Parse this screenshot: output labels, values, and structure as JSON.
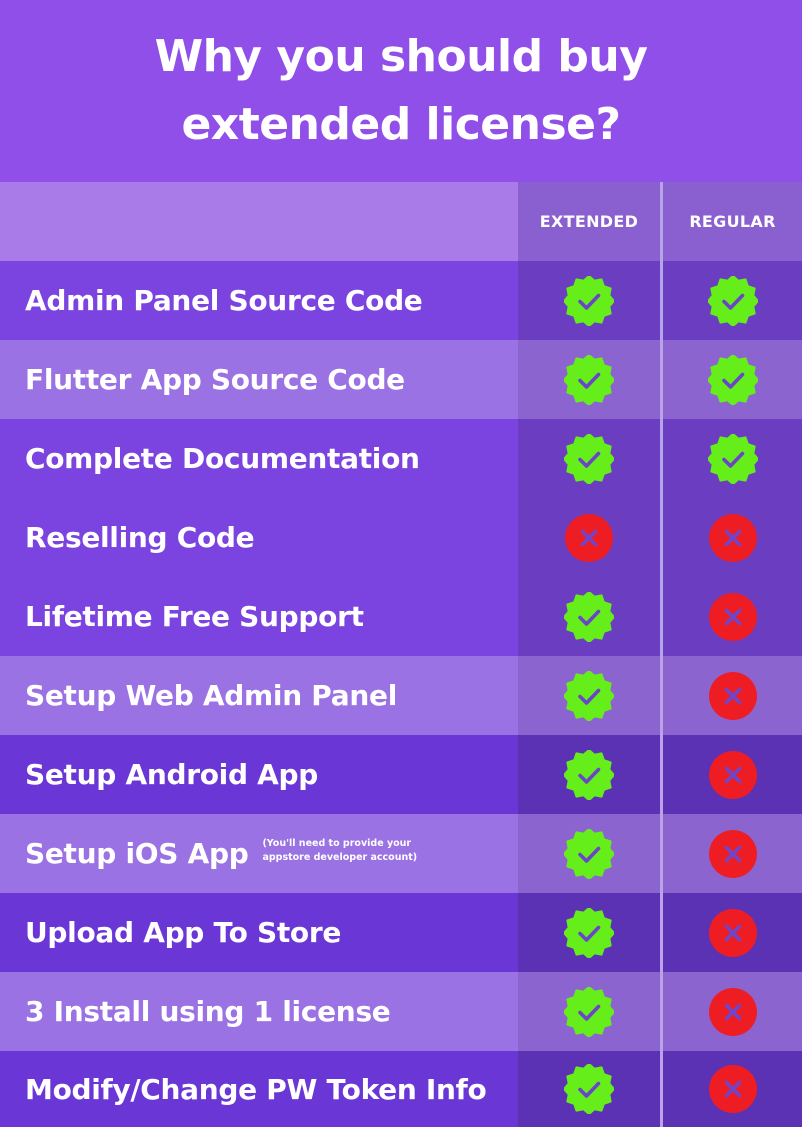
{
  "header": {
    "title": "Why you should buy extended license?"
  },
  "columns": {
    "extended": "EXTENDED",
    "regular": "REGULAR"
  },
  "colors": {
    "check": "#66ee1a",
    "cross": "#ee1d24"
  },
  "rows": [
    {
      "label": "Admin Panel Source Code",
      "note": "",
      "extended": "check",
      "regular": "check"
    },
    {
      "label": "Flutter App Source Code",
      "note": "",
      "extended": "check",
      "regular": "check"
    },
    {
      "label": "Complete Documentation",
      "note": "",
      "extended": "check",
      "regular": "check"
    },
    {
      "label": "Reselling Code",
      "note": "",
      "extended": "cross",
      "regular": "cross"
    },
    {
      "label": "Lifetime Free Support",
      "note": "",
      "extended": "check",
      "regular": "cross"
    },
    {
      "label": "Setup Web Admin Panel",
      "note": "",
      "extended": "check",
      "regular": "cross"
    },
    {
      "label": "Setup Android App",
      "note": "",
      "extended": "check",
      "regular": "cross"
    },
    {
      "label": "Setup iOS App",
      "note_line1": "(You'll need to provide your",
      "note_line2": "appstore developer account)",
      "extended": "check",
      "regular": "cross"
    },
    {
      "label": "Upload App To Store",
      "note": "",
      "extended": "check",
      "regular": "cross"
    },
    {
      "label": "3 Install using 1 license",
      "note": "",
      "extended": "check",
      "regular": "cross"
    },
    {
      "label": "Modify/Change PW Token Info",
      "note": "",
      "extended": "check",
      "regular": "cross"
    }
  ]
}
